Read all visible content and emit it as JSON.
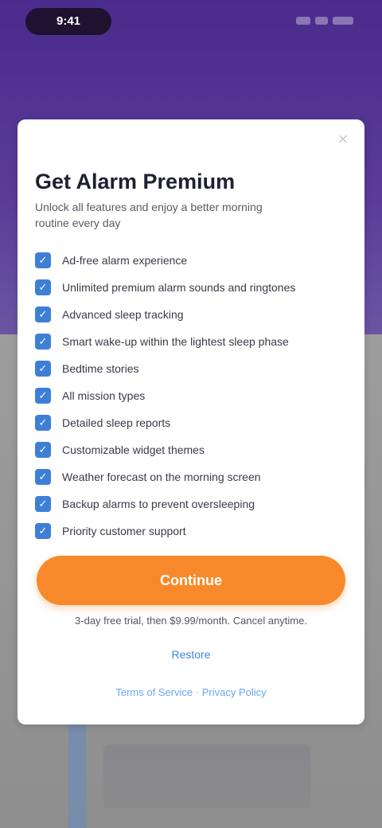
{
  "status_bar": {
    "time": "9:41"
  },
  "modal": {
    "close_symbol": "×",
    "title": "Get Alarm Premium",
    "subtitle": "Unlock all features and enjoy a better morning routine every day",
    "check_symbol": "✓",
    "features": [
      "Ad-free alarm experience",
      "Unlimited premium alarm sounds and ringtones",
      "Advanced sleep tracking",
      "Smart wake-up within the lightest sleep phase",
      "Bedtime stories",
      "All mission types",
      "Detailed sleep reports",
      "Customizable widget themes",
      "Weather forecast on the morning screen",
      "Backup alarms to prevent oversleeping",
      "Priority customer support"
    ],
    "cta_label": "Continue",
    "price_note": "3-day free trial, then $9.99/month. Cancel anytime.",
    "restore_label": "Restore",
    "terms_label": "Terms of Service · Privacy Policy"
  },
  "colors": {
    "header": "#4a2b8d",
    "accent_orange": "#f8892b",
    "check_blue": "#3e7fd6",
    "link_blue": "#3f86e0"
  },
  "icons": {
    "close": "close-icon",
    "check": "checkbox-checked-icon"
  }
}
